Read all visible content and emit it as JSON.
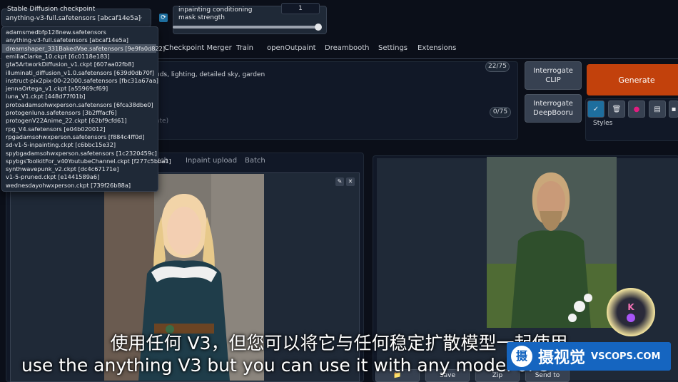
{
  "checkpoint": {
    "label": "Stable Diffusion checkpoint",
    "value": "anything-v3-full.safetensors [abcaf14e5a]",
    "options": [
      "adamsmedbfp128new.safetensors",
      "anything-v3-full.safetensors [abcaf14e5a]",
      "dreamshaper_331BakedVae.safetensors [9e9fa0d822]",
      "emiliaClarke_10.ckpt [6c0118e183]",
      "gta5ArtworkDiffusion_v1.ckpt [607aa02fb8]",
      "illuminati_diffusion_v1.0.safetensors [639d0db70f]",
      "instruct-pix2pix-00-22000.safetensors [fbc31a67aa]",
      "jennaOrtega_v1.ckpt [a55969cf69]",
      "luna_V1.ckpt [448d77f01b]",
      "protoadamsohwxperson.safetensors [6fca38dbe0]",
      "protogenluna.safetensors [3b2fffacf6]",
      "protogenV22Anime_22.ckpt [62bf9cfd61]",
      "rpg_V4.safetensors [e04b020012]",
      "rpgadamsohwxperson.safetensors [f884c4ff0d]",
      "sd-v1-5-inpainting.ckpt [c6bbc15e32]",
      "spybgadamsohwxperson.safetensors [1c2320459c]",
      "spybgsToolkitFor_v40YoutubeChannel.ckpt [f277c5bba1]",
      "synthwavepunk_v2.ckpt [dc4c67171e]",
      "v1-5-pruned.ckpt [e1441589a6]",
      "wednesdayohwxperson.ckpt [739f26b88a]"
    ],
    "refresh_icon": "refresh-icon"
  },
  "mask": {
    "label": "inpainting conditioning mask strength",
    "value": "1"
  },
  "tabs": [
    "Checkpoint Merger",
    "Train",
    "openOutpaint",
    "Dreambooth",
    "Settings",
    "Extensions"
  ],
  "prompt": {
    "text": "uds, lighting, detailed sky, garden",
    "token_count": "22/75",
    "negative_hint": "ate)",
    "negative_token_count": "0/75"
  },
  "buttons": {
    "interrogate_clip": "Interrogate CLIP",
    "interrogate_deepbooru": "Interrogate DeepBooru",
    "generate": "Generate",
    "styles": "Styles"
  },
  "subtabs": [
    "etch",
    "Inpaint upload",
    "Batch"
  ],
  "bottom": {
    "save": "Save",
    "zip": "Zip",
    "send_to": "Send to"
  },
  "subtitles": {
    "cn": "使用任何 V3，但您可以将它与任何稳定扩散模型一起使用",
    "en": "use the anything V3 but you can use it with any model of s"
  },
  "watermark": {
    "logo": "摄",
    "cn": "摄视觉",
    "en": "VSCOPS.COM"
  },
  "avatar": {
    "letter": "K"
  },
  "colors": {
    "generate": "#c2410c",
    "accent": "#1e6e9e",
    "watermark": "#1565c0"
  }
}
